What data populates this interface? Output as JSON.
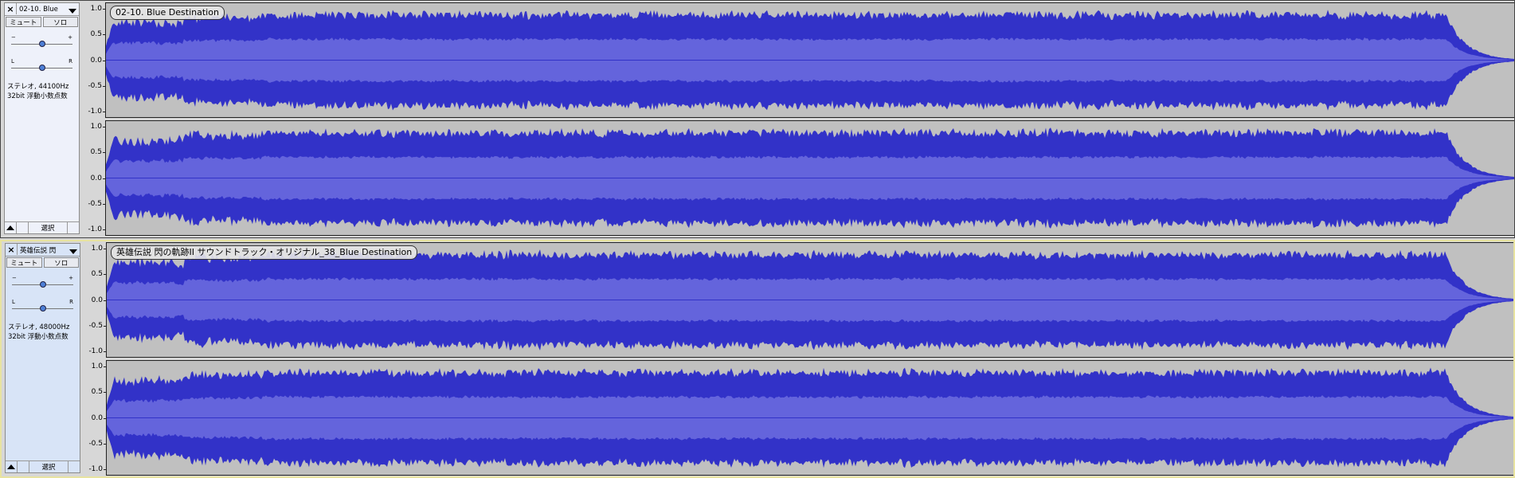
{
  "tracks": [
    {
      "name": "02-10. Blue",
      "clip_name": "02-10. Blue Destination",
      "mute": "ミュート",
      "solo": "ソロ",
      "gain_minus": "−",
      "gain_plus": "+",
      "pan_left": "L",
      "pan_right": "R",
      "info_line1": "ステレオ, 44100Hz",
      "info_line2": "32bit 浮動小数点数",
      "select": "選択",
      "scale": [
        "1.0",
        "0.5",
        "0.0",
        "-0.5",
        "-1.0"
      ],
      "gain_level": 0.5,
      "pan_level": 0.5
    },
    {
      "name": "英雄伝説 閃",
      "clip_name": "英雄伝説 閃の軌跡II サウンドトラック・オリジナル_38_Blue Destination",
      "mute": "ミュート",
      "solo": "ソロ",
      "gain_minus": "−",
      "gain_plus": "+",
      "pan_left": "L",
      "pan_right": "R",
      "info_line1": "ステレオ, 48000Hz",
      "info_line2": "32bit 浮動小数点数",
      "select": "選択",
      "scale": [
        "1.0",
        "0.5",
        "0.0",
        "-0.5",
        "-1.0"
      ],
      "gain_level": 0.5,
      "pan_level": 0.5
    }
  ],
  "colors": {
    "waveform_peak": "#3232c8",
    "waveform_rms": "#6464dc",
    "waveform_bg": "#c0c0c0",
    "focus_border": "#e8e3a0"
  },
  "icons": {
    "close": "close-icon",
    "menu": "chevron-down-icon",
    "collapse": "chevron-up-icon"
  }
}
